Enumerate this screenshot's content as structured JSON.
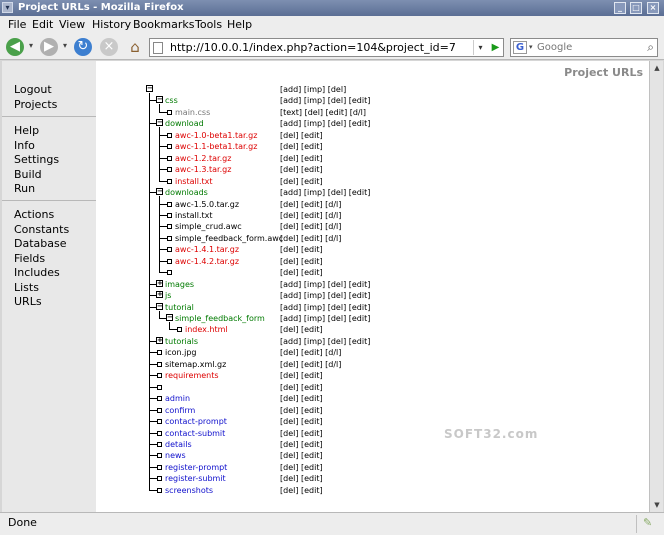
{
  "window": {
    "title": "Project URLs - Mozilla Firefox"
  },
  "menu": [
    "File",
    "Edit",
    "View",
    "History",
    "Bookmarks",
    "Tools",
    "Help"
  ],
  "menu_accel": [
    "F",
    "E",
    "V",
    "H",
    "B",
    "T",
    "H"
  ],
  "nav": {
    "url": "http://10.0.0.1/index.php?action=104&project_id=7",
    "search_placeholder": "Google"
  },
  "sidebar": {
    "groups": [
      [
        "Logout",
        "Projects"
      ],
      [
        "Help",
        "Info",
        "Settings",
        "Build",
        "Run"
      ],
      [
        "Actions",
        "Constants",
        "Database",
        "Fields",
        "Includes",
        "Lists",
        "URLs"
      ]
    ]
  },
  "page": {
    "title": "Project URLs"
  },
  "tree": [
    {
      "depth": 0,
      "kind": "box",
      "sign": "−",
      "label": "",
      "color": "black",
      "actions": "[add] [imp] [del]"
    },
    {
      "depth": 1,
      "kind": "box",
      "sign": "−",
      "label": "css",
      "color": "green",
      "actions": "[add] [imp] [del] [edit]"
    },
    {
      "depth": 2,
      "kind": "pt",
      "label": "main.css",
      "color": "gray",
      "actions": "[text] [del] [edit] [d/l]"
    },
    {
      "depth": 1,
      "kind": "box",
      "sign": "−",
      "label": "download",
      "color": "green",
      "actions": "[add] [imp] [del] [edit]"
    },
    {
      "depth": 2,
      "kind": "pt",
      "label": "awc-1.0-beta1.tar.gz",
      "color": "red",
      "actions": "[del] [edit]"
    },
    {
      "depth": 2,
      "kind": "pt",
      "label": "awc-1.1-beta1.tar.gz",
      "color": "red",
      "actions": "[del] [edit]"
    },
    {
      "depth": 2,
      "kind": "pt",
      "label": "awc-1.2.tar.gz",
      "color": "red",
      "actions": "[del] [edit]"
    },
    {
      "depth": 2,
      "kind": "pt",
      "label": "awc-1.3.tar.gz",
      "color": "red",
      "actions": "[del] [edit]"
    },
    {
      "depth": 2,
      "kind": "pt",
      "label": "install.txt",
      "color": "red",
      "actions": "[del] [edit]"
    },
    {
      "depth": 1,
      "kind": "box",
      "sign": "−",
      "label": "downloads",
      "color": "green",
      "actions": "[add] [imp] [del] [edit]"
    },
    {
      "depth": 2,
      "kind": "pt",
      "label": "awc-1.5.0.tar.gz",
      "color": "black",
      "actions": "[del] [edit] [d/l]"
    },
    {
      "depth": 2,
      "kind": "pt",
      "label": "install.txt",
      "color": "black",
      "actions": "[del] [edit] [d/l]"
    },
    {
      "depth": 2,
      "kind": "pt",
      "label": "simple_crud.awc",
      "color": "black",
      "actions": "[del] [edit] [d/l]"
    },
    {
      "depth": 2,
      "kind": "pt",
      "label": "simple_feedback_form.awc",
      "color": "black",
      "actions": "[del] [edit] [d/l]"
    },
    {
      "depth": 2,
      "kind": "pt",
      "label": "awc-1.4.1.tar.gz",
      "color": "red",
      "actions": "[del] [edit]"
    },
    {
      "depth": 2,
      "kind": "pt",
      "label": "awc-1.4.2.tar.gz",
      "color": "red",
      "actions": "[del] [edit]"
    },
    {
      "depth": 2,
      "kind": "pt",
      "label": "",
      "color": "black",
      "actions": "[del] [edit]"
    },
    {
      "depth": 1,
      "kind": "box",
      "sign": "+",
      "label": "images",
      "color": "green",
      "actions": "[add] [imp] [del] [edit]"
    },
    {
      "depth": 1,
      "kind": "box",
      "sign": "+",
      "label": "js",
      "color": "green",
      "actions": "[add] [imp] [del] [edit]"
    },
    {
      "depth": 1,
      "kind": "box",
      "sign": "−",
      "label": "tutorial",
      "color": "green",
      "actions": "[add] [imp] [del] [edit]"
    },
    {
      "depth": 2,
      "kind": "box",
      "sign": "−",
      "label": "simple_feedback_form",
      "color": "green",
      "actions": "[add] [imp] [del] [edit]"
    },
    {
      "depth": 3,
      "kind": "pt",
      "label": "index.html",
      "color": "red",
      "actions": "[del] [edit]"
    },
    {
      "depth": 1,
      "kind": "box",
      "sign": "+",
      "label": "tutorials",
      "color": "green",
      "actions": "[add] [imp] [del] [edit]"
    },
    {
      "depth": 1,
      "kind": "pt",
      "label": "icon.jpg",
      "color": "black",
      "actions": "[del] [edit] [d/l]"
    },
    {
      "depth": 1,
      "kind": "pt",
      "label": "sitemap.xml.gz",
      "color": "black",
      "actions": "[del] [edit] [d/l]"
    },
    {
      "depth": 1,
      "kind": "pt",
      "label": "requirements",
      "color": "red",
      "actions": "[del] [edit]"
    },
    {
      "depth": 1,
      "kind": "pt",
      "label": "",
      "color": "black",
      "actions": "[del] [edit]"
    },
    {
      "depth": 1,
      "kind": "pt",
      "label": "admin",
      "color": "blue",
      "actions": "[del] [edit]"
    },
    {
      "depth": 1,
      "kind": "pt",
      "label": "confirm",
      "color": "blue",
      "actions": "[del] [edit]"
    },
    {
      "depth": 1,
      "kind": "pt",
      "label": "contact-prompt",
      "color": "blue",
      "actions": "[del] [edit]"
    },
    {
      "depth": 1,
      "kind": "pt",
      "label": "contact-submit",
      "color": "blue",
      "actions": "[del] [edit]"
    },
    {
      "depth": 1,
      "kind": "pt",
      "label": "details",
      "color": "blue",
      "actions": "[del] [edit]"
    },
    {
      "depth": 1,
      "kind": "pt",
      "label": "news",
      "color": "blue",
      "actions": "[del] [edit]"
    },
    {
      "depth": 1,
      "kind": "pt",
      "label": "register-prompt",
      "color": "blue",
      "actions": "[del] [edit]"
    },
    {
      "depth": 1,
      "kind": "pt",
      "label": "register-submit",
      "color": "blue",
      "actions": "[del] [edit]"
    },
    {
      "depth": 1,
      "kind": "pt",
      "label": "screenshots",
      "color": "blue",
      "actions": "[del] [edit]"
    }
  ],
  "status": {
    "text": "Done"
  },
  "watermark": "SOFT32.com"
}
